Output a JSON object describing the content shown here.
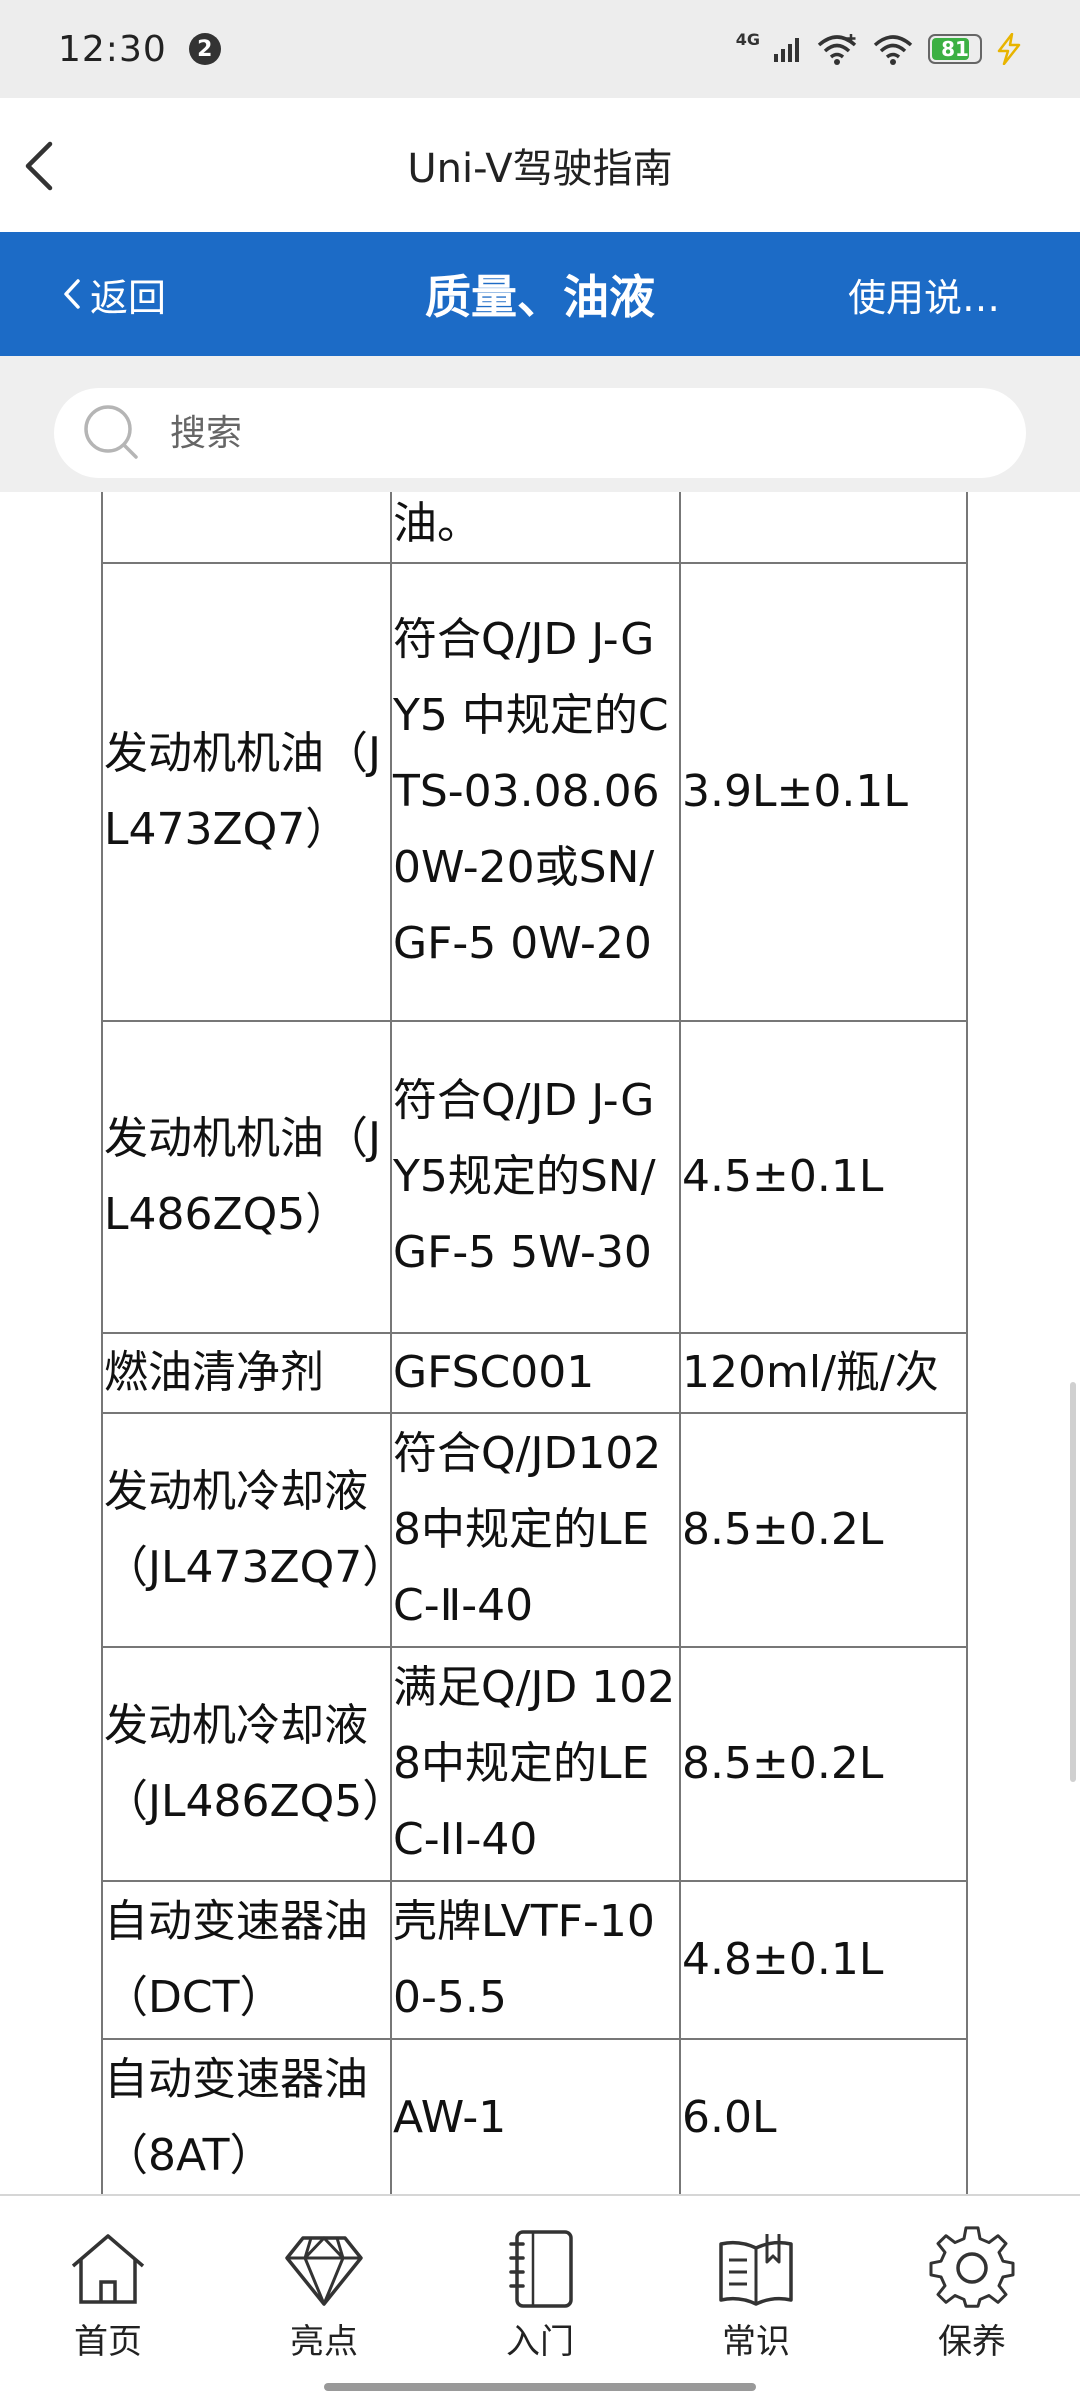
{
  "status_bar": {
    "time": "12:30",
    "notification_count": "2",
    "network": "4G",
    "battery_level": "81",
    "battery_fraction": 0.81,
    "battery_color": "#3cb043"
  },
  "app_header": {
    "title": "Uni-V驾驶指南",
    "back_icon": "chevron-left-icon"
  },
  "toolbar": {
    "back_label": "返回",
    "title": "质量、油液",
    "help_label": "使用说…",
    "background": "#1c6bc6"
  },
  "search": {
    "placeholder": "搜索",
    "value": ""
  },
  "table": {
    "rows": [
      {
        "cells": [
          "",
          "油。",
          ""
        ]
      },
      {
        "cells": [
          "发动机机油（JL473ZQ7）",
          "符合Q/JD J-GY5 中规定的CTS-03.08.06 0W-20或SN/GF-5 0W-20",
          "3.9L±0.1L"
        ]
      },
      {
        "cells": [
          "发动机机油（JL486ZQ5）",
          "符合Q/JD J-GY5规定的SN/GF-5 5W-30",
          "4.5±0.1L"
        ]
      },
      {
        "cells": [
          "燃油清净剂",
          "GFSC001",
          "120ml/瓶/次"
        ]
      },
      {
        "cells": [
          "发动机冷却液（JL473ZQ7）",
          "符合Q/JD1028中规定的LEC-Ⅱ-40",
          "8.5±0.2L"
        ]
      },
      {
        "cells": [
          "发动机冷却液（JL486ZQ5）",
          "满足Q/JD 1028中规定的LEC-II-40",
          "8.5±0.2L"
        ]
      },
      {
        "cells": [
          "自动变速器油（DCT）",
          "壳牌LVTF-100-5.5",
          "4.8±0.1L"
        ]
      },
      {
        "cells": [
          "自动变速器油（8AT）",
          "AW-1",
          "6.0L"
        ]
      }
    ]
  },
  "bottom_nav": {
    "items": [
      {
        "label": "首页",
        "icon": "home-icon"
      },
      {
        "label": "亮点",
        "icon": "diamond-icon"
      },
      {
        "label": "入门",
        "icon": "notebook-icon"
      },
      {
        "label": "常识",
        "icon": "book-icon"
      },
      {
        "label": "保养",
        "icon": "gear-icon"
      }
    ]
  }
}
